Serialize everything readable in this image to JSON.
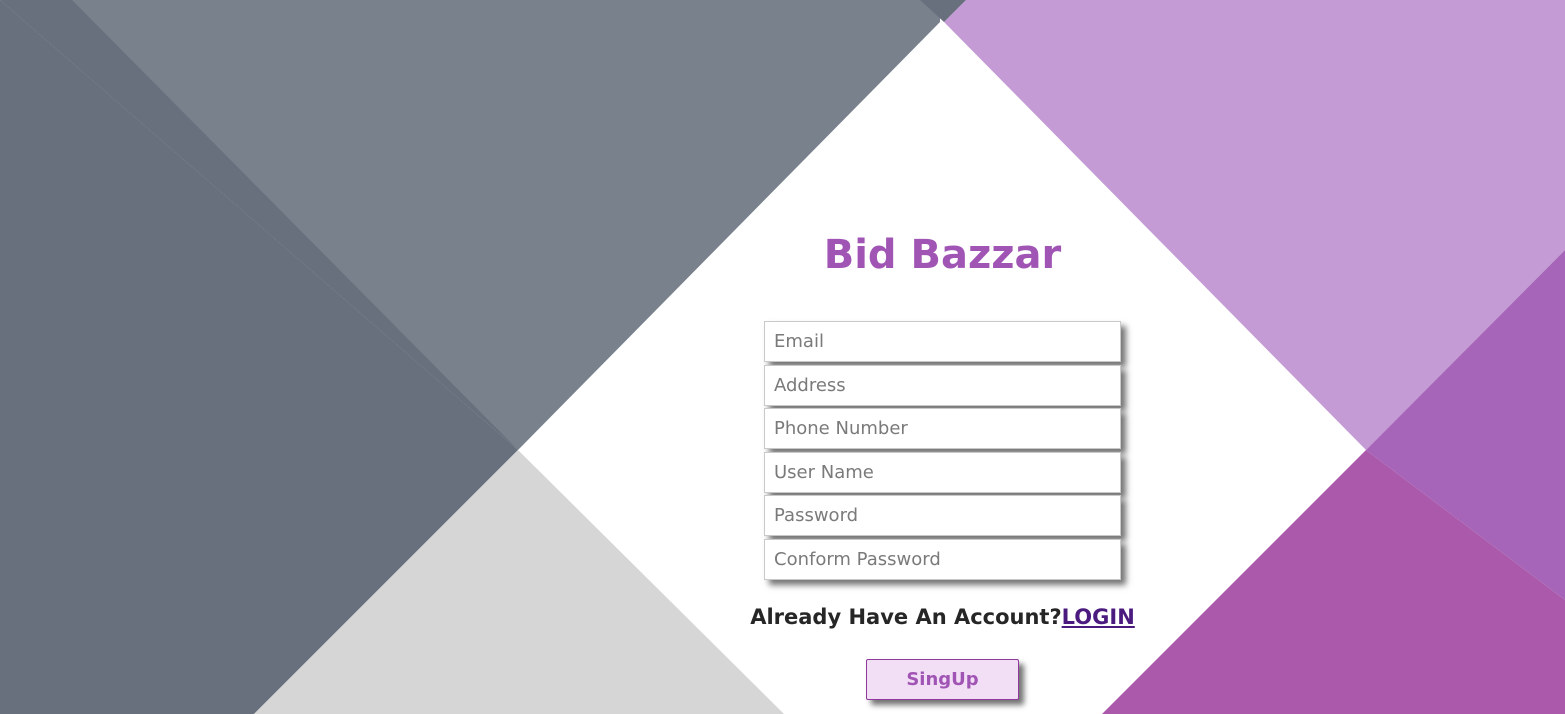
{
  "app": {
    "title": "Bid Bazzar"
  },
  "form": {
    "fields": [
      {
        "name": "email",
        "placeholder": "Email",
        "value": ""
      },
      {
        "name": "address",
        "placeholder": "Address",
        "value": ""
      },
      {
        "name": "phone",
        "placeholder": "Phone Number",
        "value": ""
      },
      {
        "name": "username",
        "placeholder": "User Name",
        "value": ""
      },
      {
        "name": "password",
        "placeholder": "Password",
        "value": ""
      },
      {
        "name": "confirm_password",
        "placeholder": "Conform Password",
        "value": ""
      }
    ],
    "account_prompt": "Already Have An Account?",
    "login_link": "LOGIN",
    "submit_label": "SingUp"
  },
  "colors": {
    "title": "#a055b5",
    "prompt_text": "#262626",
    "login_link": "#4a1a7e",
    "button_bg": "#f2dff5",
    "button_text": "#a055b5",
    "gray_dark": "#67707c",
    "gray_mid": "#78818c",
    "gray_light": "#d6d6d6",
    "purple_light": "#c49bd5",
    "purple_mid": "#a665b8",
    "purple_dark": "#ab5aab"
  }
}
